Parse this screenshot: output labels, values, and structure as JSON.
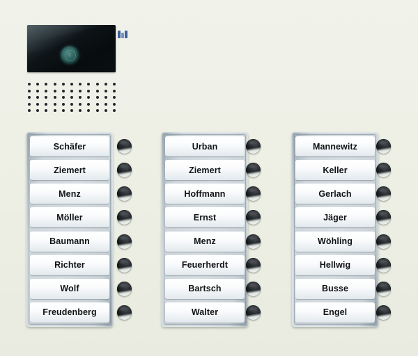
{
  "device": {
    "brand_logo": "tcs-logo",
    "background_color": "#eef0e6",
    "panel_frame_color": "#c9d2d7",
    "plate_color": "#ffffff",
    "button_color": "#14181a",
    "lens_color": "#356a66"
  },
  "camera": {
    "name": "camera-module",
    "lens": "camera-lens"
  },
  "speaker": {
    "name": "speaker-grille",
    "columns": 11,
    "rows": 5
  },
  "panels": [
    {
      "name": "nameplate-panel-1",
      "entries": [
        "Schäfer",
        "Ziemert",
        "Menz",
        "Möller",
        "Baumann",
        "Richter",
        "Wolf",
        "Freudenberg"
      ]
    },
    {
      "name": "nameplate-panel-2",
      "entries": [
        "Urban",
        "Ziemert",
        "Hoffmann",
        "Ernst",
        "Menz",
        "Feuerherdt",
        "Bartsch",
        "Walter"
      ]
    },
    {
      "name": "nameplate-panel-3",
      "entries": [
        "Mannewitz",
        "Keller",
        "Gerlach",
        "Jäger",
        "Wöhling",
        "Hellwig",
        "Busse",
        "Engel"
      ]
    }
  ]
}
